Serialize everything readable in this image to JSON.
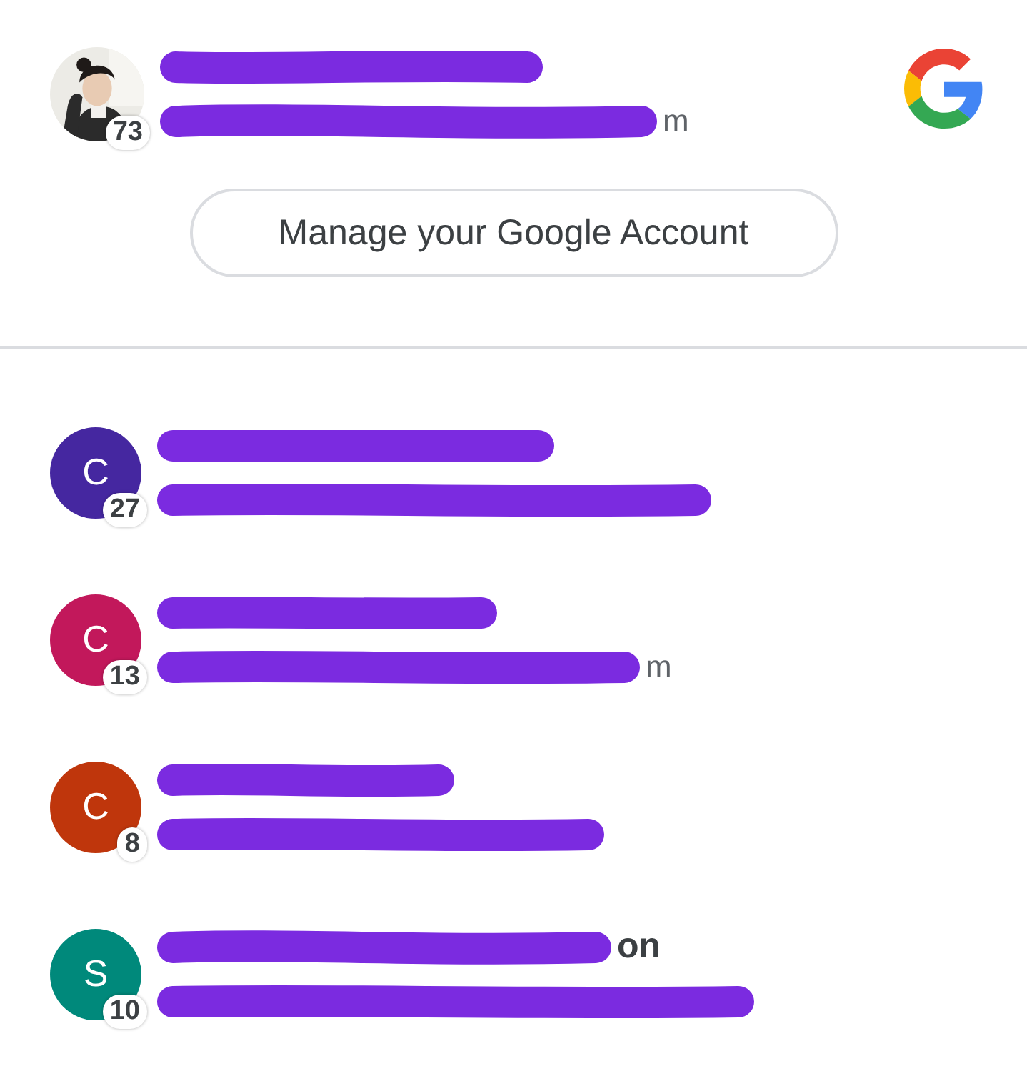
{
  "current_account": {
    "badge": "73",
    "email_visible": "m"
  },
  "manage_button": "Manage your Google Account",
  "accounts": [
    {
      "initial": "C",
      "color": "#4527a0",
      "badge": "27"
    },
    {
      "initial": "C",
      "color": "#c2185b",
      "badge": "13",
      "email_visible": "m"
    },
    {
      "initial": "C",
      "color": "#bf360c",
      "badge": "8"
    },
    {
      "initial": "S",
      "color": "#00897b",
      "badge": "10",
      "name_visible": "on"
    }
  ]
}
